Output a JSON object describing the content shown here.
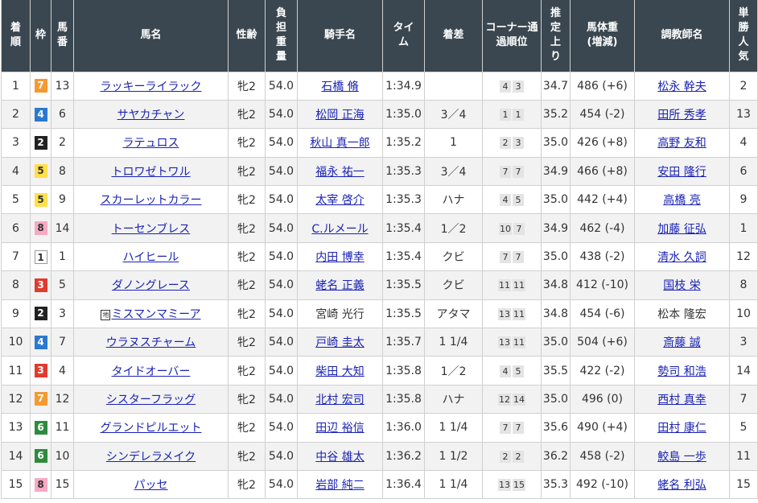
{
  "headers": {
    "finish": "着順",
    "frame": "枠",
    "number": "馬番",
    "horse": "馬名",
    "sex_age": "性齢",
    "weight": "負担重量",
    "jockey": "騎手名",
    "time": "タイム",
    "margin": "着差",
    "passing": "コーナー通過順位",
    "last3f": "推定上り",
    "body_weight": "馬体重",
    "body_weight_sub": "(増減)",
    "trainer": "調教師名",
    "popularity": "単勝人気"
  },
  "colors": {
    "header_bg": "#3a4750",
    "link": "#1a23b5",
    "frame_1": "#ffffff",
    "frame_2": "#222222",
    "frame_3": "#e03b2f",
    "frame_4": "#2b78d0",
    "frame_5": "#ffe04a",
    "frame_6": "#2e8b3d",
    "frame_7": "#f59a32",
    "frame_8": "#f7a9c3"
  },
  "rows": [
    {
      "finish": "1",
      "frame": "7",
      "number": "13",
      "horse": "ラッキーライラック",
      "chi": "",
      "sex_age": "牝2",
      "weight": "54.0",
      "jockey": "石橋 脩",
      "jockey_link": true,
      "time": "1:34.9",
      "margin": "",
      "passing": [
        "4",
        "3"
      ],
      "last3f": "34.7",
      "body_weight": "486 (+6)",
      "trainer": "松永 幹夫",
      "trainer_link": true,
      "popularity": "2"
    },
    {
      "finish": "2",
      "frame": "4",
      "number": "6",
      "horse": "サヤカチャン",
      "chi": "",
      "sex_age": "牝2",
      "weight": "54.0",
      "jockey": "松岡 正海",
      "jockey_link": true,
      "time": "1:35.0",
      "margin": "3／4",
      "passing": [
        "1",
        "1"
      ],
      "last3f": "35.2",
      "body_weight": "454 (-2)",
      "trainer": "田所 秀孝",
      "trainer_link": true,
      "popularity": "13"
    },
    {
      "finish": "3",
      "frame": "2",
      "number": "2",
      "horse": "ラテュロス",
      "chi": "",
      "sex_age": "牝2",
      "weight": "54.0",
      "jockey": "秋山 真一郎",
      "jockey_link": true,
      "time": "1:35.2",
      "margin": "1",
      "passing": [
        "2",
        "3"
      ],
      "last3f": "35.0",
      "body_weight": "426 (+8)",
      "trainer": "高野 友和",
      "trainer_link": true,
      "popularity": "4"
    },
    {
      "finish": "4",
      "frame": "5",
      "number": "8",
      "horse": "トロワゼトワル",
      "chi": "",
      "sex_age": "牝2",
      "weight": "54.0",
      "jockey": "福永 祐一",
      "jockey_link": true,
      "time": "1:35.3",
      "margin": "3／4",
      "passing": [
        "7",
        "7"
      ],
      "last3f": "34.9",
      "body_weight": "466 (+8)",
      "trainer": "安田 隆行",
      "trainer_link": true,
      "popularity": "6"
    },
    {
      "finish": "5",
      "frame": "5",
      "number": "9",
      "horse": "スカーレットカラー",
      "chi": "",
      "sex_age": "牝2",
      "weight": "54.0",
      "jockey": "太宰 啓介",
      "jockey_link": true,
      "time": "1:35.3",
      "margin": "ハナ",
      "passing": [
        "4",
        "5"
      ],
      "last3f": "35.0",
      "body_weight": "442 (+4)",
      "trainer": "高橋 亮",
      "trainer_link": true,
      "popularity": "9"
    },
    {
      "finish": "6",
      "frame": "8",
      "number": "14",
      "horse": "トーセンブレス",
      "chi": "",
      "sex_age": "牝2",
      "weight": "54.0",
      "jockey": "C.ルメール",
      "jockey_link": true,
      "time": "1:35.4",
      "margin": "1／2",
      "passing": [
        "10",
        "7"
      ],
      "last3f": "34.9",
      "body_weight": "462 (-4)",
      "trainer": "加藤 征弘",
      "trainer_link": true,
      "popularity": "1"
    },
    {
      "finish": "7",
      "frame": "1",
      "number": "1",
      "horse": "ハイヒール",
      "chi": "",
      "sex_age": "牝2",
      "weight": "54.0",
      "jockey": "内田 博幸",
      "jockey_link": true,
      "time": "1:35.4",
      "margin": "クビ",
      "passing": [
        "7",
        "7"
      ],
      "last3f": "35.0",
      "body_weight": "438 (-2)",
      "trainer": "清水 久詞",
      "trainer_link": true,
      "popularity": "12"
    },
    {
      "finish": "8",
      "frame": "3",
      "number": "5",
      "horse": "ダノングレース",
      "chi": "",
      "sex_age": "牝2",
      "weight": "54.0",
      "jockey": "蛯名 正義",
      "jockey_link": true,
      "time": "1:35.5",
      "margin": "クビ",
      "passing": [
        "11",
        "11"
      ],
      "last3f": "34.8",
      "body_weight": "412 (-10)",
      "trainer": "国枝 栄",
      "trainer_link": true,
      "popularity": "8"
    },
    {
      "finish": "9",
      "frame": "2",
      "number": "3",
      "horse": "ミスマンマミーア",
      "chi": "地",
      "sex_age": "牝2",
      "weight": "54.0",
      "jockey": "宮崎 光行",
      "jockey_link": false,
      "time": "1:35.5",
      "margin": "アタマ",
      "passing": [
        "13",
        "11"
      ],
      "last3f": "34.8",
      "body_weight": "454 (-6)",
      "trainer": "松本 隆宏",
      "trainer_link": false,
      "popularity": "10"
    },
    {
      "finish": "10",
      "frame": "4",
      "number": "7",
      "horse": "ウラヌスチャーム",
      "chi": "",
      "sex_age": "牝2",
      "weight": "54.0",
      "jockey": "戸崎 圭太",
      "jockey_link": true,
      "time": "1:35.7",
      "margin": "1 1/4",
      "passing": [
        "13",
        "11"
      ],
      "last3f": "35.0",
      "body_weight": "504 (+6)",
      "trainer": "斎藤 誠",
      "trainer_link": true,
      "popularity": "3"
    },
    {
      "finish": "11",
      "frame": "3",
      "number": "4",
      "horse": "タイドオーバー",
      "chi": "",
      "sex_age": "牝2",
      "weight": "54.0",
      "jockey": "柴田 大知",
      "jockey_link": true,
      "time": "1:35.8",
      "margin": "1／2",
      "passing": [
        "4",
        "5"
      ],
      "last3f": "35.5",
      "body_weight": "422 (-2)",
      "trainer": "勢司 和浩",
      "trainer_link": true,
      "popularity": "14"
    },
    {
      "finish": "12",
      "frame": "7",
      "number": "12",
      "horse": "シスターフラッグ",
      "chi": "",
      "sex_age": "牝2",
      "weight": "54.0",
      "jockey": "北村 宏司",
      "jockey_link": true,
      "time": "1:35.8",
      "margin": "ハナ",
      "passing": [
        "12",
        "14"
      ],
      "last3f": "35.0",
      "body_weight": "496 (0)",
      "trainer": "西村 真幸",
      "trainer_link": true,
      "popularity": "7"
    },
    {
      "finish": "13",
      "frame": "6",
      "number": "11",
      "horse": "グランドピルエット",
      "chi": "",
      "sex_age": "牝2",
      "weight": "54.0",
      "jockey": "田辺 裕信",
      "jockey_link": true,
      "time": "1:36.0",
      "margin": "1 1/4",
      "passing": [
        "7",
        "7"
      ],
      "last3f": "35.6",
      "body_weight": "490 (+4)",
      "trainer": "田村 康仁",
      "trainer_link": true,
      "popularity": "5"
    },
    {
      "finish": "14",
      "frame": "6",
      "number": "10",
      "horse": "シンデレラメイク",
      "chi": "",
      "sex_age": "牝2",
      "weight": "54.0",
      "jockey": "中谷 雄太",
      "jockey_link": true,
      "time": "1:36.2",
      "margin": "1 1/2",
      "passing": [
        "2",
        "2"
      ],
      "last3f": "36.2",
      "body_weight": "458 (-2)",
      "trainer": "鮫島 一歩",
      "trainer_link": true,
      "popularity": "11"
    },
    {
      "finish": "15",
      "frame": "8",
      "number": "15",
      "horse": "パッセ",
      "chi": "",
      "sex_age": "牝2",
      "weight": "54.0",
      "jockey": "岩部 純二",
      "jockey_link": true,
      "time": "1:36.4",
      "margin": "1 1/4",
      "passing": [
        "13",
        "15"
      ],
      "last3f": "35.3",
      "body_weight": "492 (-10)",
      "trainer": "蛯名 利弘",
      "trainer_link": true,
      "popularity": "15"
    }
  ]
}
